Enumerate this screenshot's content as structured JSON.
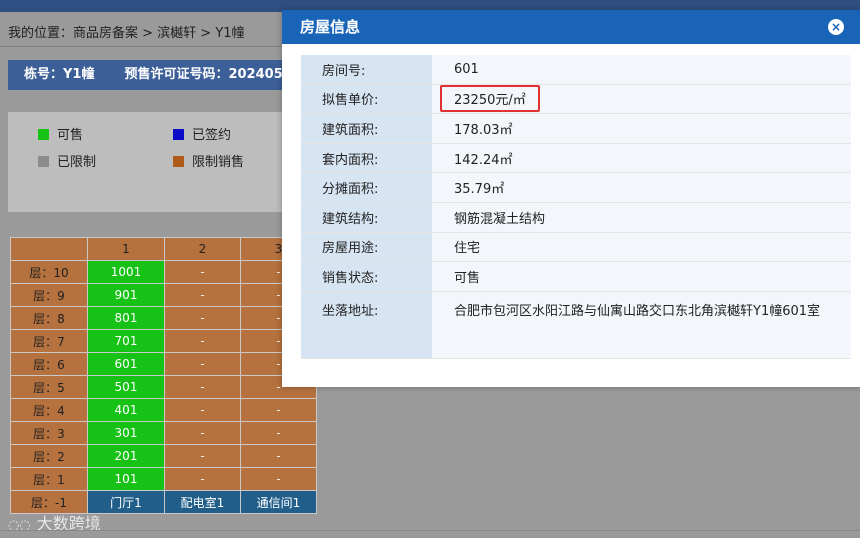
{
  "breadcrumb": "我的位置：商品房备案 > 滨樾轩 > Y1幢",
  "info_bar": {
    "building": "栋号：Y1幢",
    "permit": "预售许可证号码：202405"
  },
  "legend": [
    {
      "label": "可售",
      "color": "#17c217"
    },
    {
      "label": "已签约",
      "color": "#0b0bc8"
    },
    {
      "label": "已限制",
      "color": "#8c8c8c"
    },
    {
      "label": "限制销售",
      "color": "#b05a1a"
    }
  ],
  "grid": {
    "columns": [
      "1",
      "2",
      "3"
    ],
    "rows": [
      {
        "floor": "层：10",
        "cells": [
          "1001",
          "-",
          "-"
        ]
      },
      {
        "floor": "层：9",
        "cells": [
          "901",
          "-",
          "-"
        ]
      },
      {
        "floor": "层：8",
        "cells": [
          "801",
          "-",
          "-"
        ]
      },
      {
        "floor": "层：7",
        "cells": [
          "701",
          "-",
          "-"
        ]
      },
      {
        "floor": "层：6",
        "cells": [
          "601",
          "-",
          "-"
        ]
      },
      {
        "floor": "层：5",
        "cells": [
          "501",
          "-",
          "-"
        ]
      },
      {
        "floor": "层：4",
        "cells": [
          "401",
          "-",
          "-"
        ]
      },
      {
        "floor": "层：3",
        "cells": [
          "301",
          "-",
          "-"
        ]
      },
      {
        "floor": "层：2",
        "cells": [
          "201",
          "-",
          "-"
        ]
      },
      {
        "floor": "层：1",
        "cells": [
          "101",
          "-",
          "-"
        ]
      }
    ],
    "basement": {
      "floor": "层：-1",
      "cells": [
        "门厅1",
        "配电室1",
        "通信间1"
      ]
    }
  },
  "watermark": "大数跨境",
  "modal": {
    "title": "房屋信息",
    "close_icon": "×",
    "fields": [
      {
        "label": "房间号:",
        "value": "601"
      },
      {
        "label": "拟售单价:",
        "value": "23250元/㎡"
      },
      {
        "label": "建筑面积:",
        "value": "178.03㎡"
      },
      {
        "label": "套内面积:",
        "value": "142.24㎡"
      },
      {
        "label": "分摊面积:",
        "value": "35.79㎡"
      },
      {
        "label": "建筑结构:",
        "value": "钢筋混凝土结构"
      },
      {
        "label": "房屋用途:",
        "value": "住宅"
      },
      {
        "label": "销售状态:",
        "value": "可售"
      },
      {
        "label": "坐落地址:",
        "value": "合肥市包河区水阳江路与仙寓山路交口东北角滨樾轩Y1幢601室"
      }
    ]
  }
}
